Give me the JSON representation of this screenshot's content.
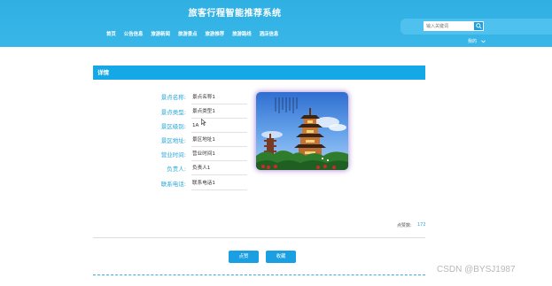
{
  "header": {
    "title": "旅客行程智能推荐系统",
    "search_placeholder": "输入关键词",
    "nav": [
      "首页",
      "公告信息",
      "旅游新闻",
      "旅游景点",
      "旅游推荐",
      "旅游路线",
      "酒店信息"
    ],
    "user_menu": "我的"
  },
  "detail": {
    "section_title": "详情",
    "fields": [
      {
        "label": "景点名称:",
        "value": "景点名称1"
      },
      {
        "label": "景点类型:",
        "value": "景点类型1"
      },
      {
        "label": "景区级别:",
        "value": "1A"
      },
      {
        "label": "景区地址:",
        "value": "景区地址1"
      },
      {
        "label": "营业时间:",
        "value": "营业时间1"
      },
      {
        "label": "负责人:",
        "value": "负责人1"
      },
      {
        "label": "联系电话:",
        "value": "联系电话1"
      }
    ],
    "click_label": "点赞数:",
    "click_count": "172",
    "buttons": {
      "like": "点赞",
      "favorite": "收藏"
    }
  },
  "watermark": "CSDN @BYSJ1987",
  "colors": {
    "primary": "#14a8e6",
    "header": "#2fb0e3",
    "label": "#27a8d8"
  }
}
